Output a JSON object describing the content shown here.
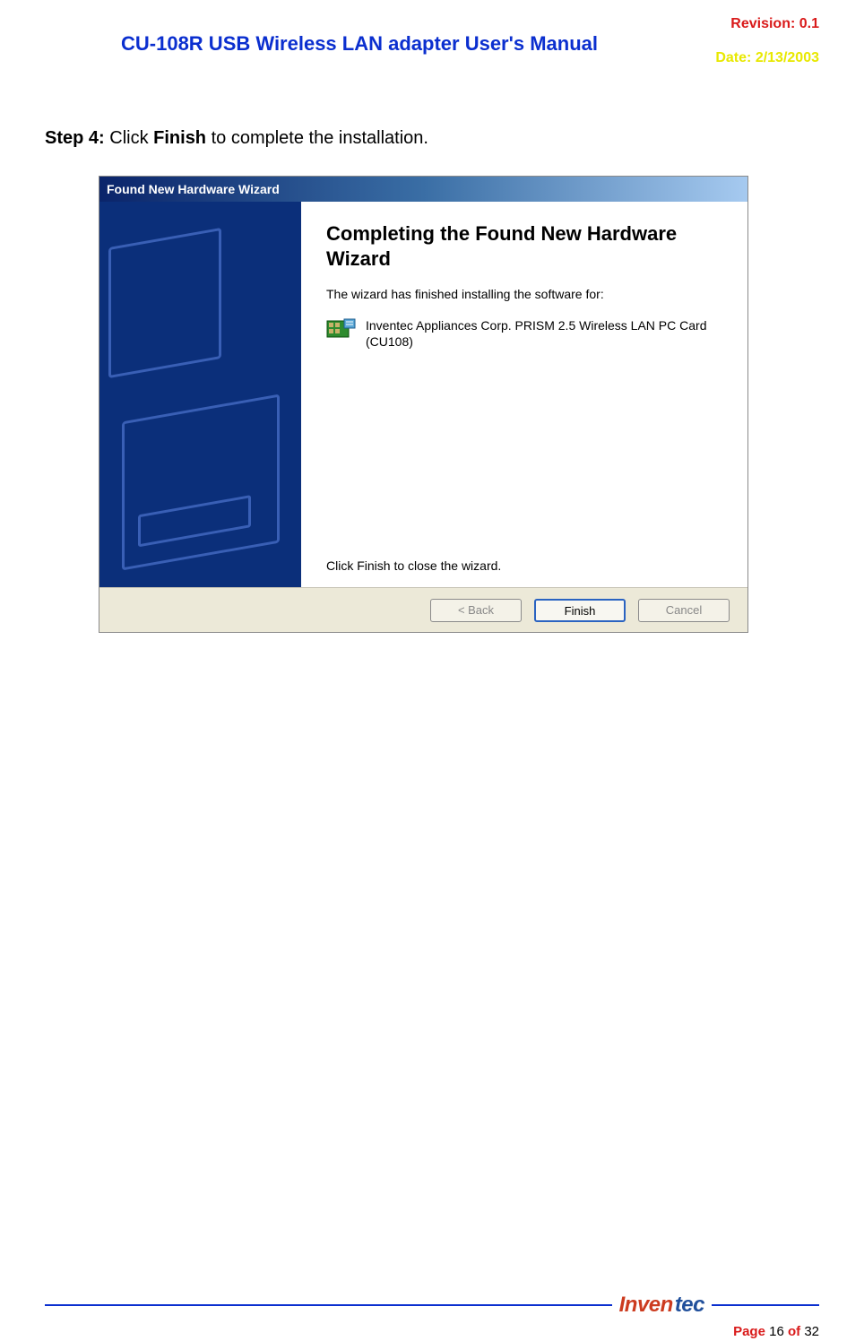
{
  "header": {
    "revision_label": "Revision:",
    "revision_value": "0.1",
    "title": "CU-108R USB Wireless LAN adapter User's Manual",
    "date_label": "Date:",
    "date_value": "2/13/2003"
  },
  "body": {
    "step_label": "Step 4:",
    "step_text_pre": " Click ",
    "step_bold_word": "Finish",
    "step_text_post": " to complete the installation."
  },
  "dialog": {
    "titlebar": "Found New Hardware Wizard",
    "heading": "Completing the Found New Hardware Wizard",
    "finished_text": "The wizard has finished installing the software for:",
    "device_name": "Inventec Appliances Corp. PRISM 2.5 Wireless LAN PC Card (CU108)",
    "close_hint": "Click Finish to close the wizard.",
    "buttons": {
      "back": "< Back",
      "finish": "Finish",
      "cancel": "Cancel"
    }
  },
  "footer": {
    "logo_red": "Inven",
    "logo_blue": "tec",
    "page_label": "Page",
    "page_current": "16",
    "page_sep": "of",
    "page_total": "32"
  }
}
